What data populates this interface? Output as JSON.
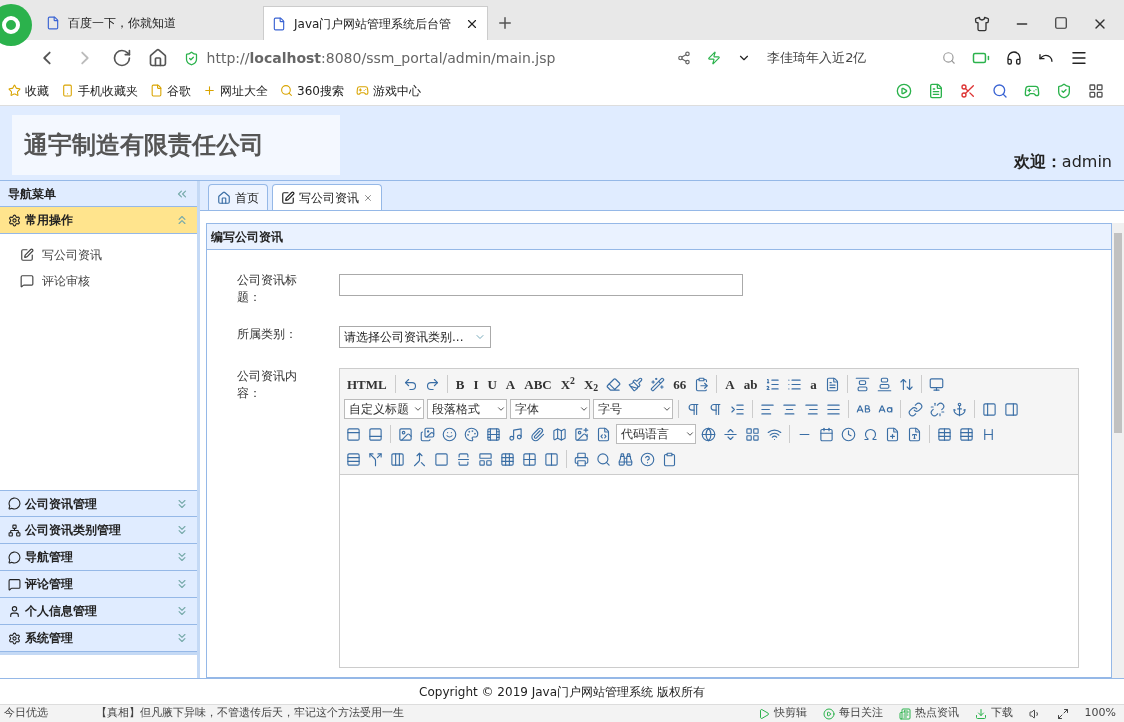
{
  "browser": {
    "tabs": [
      {
        "label": "百度一下，你就知道",
        "selected": false
      },
      {
        "label": "Java门户网站管理系统后台管",
        "selected": true
      }
    ],
    "url": "http://**localhost**:8080/ssm_portal/admin/main.jsp",
    "search_hint": "李佳琦年入近2亿",
    "bookmarks": [
      "收藏",
      "手机收藏夹",
      "谷歌",
      "网址大全",
      "360搜索",
      "游戏中心"
    ]
  },
  "header": {
    "company": "通宇制造有限责任公司",
    "welcome": "欢迎：",
    "user": "admin"
  },
  "sidebar": {
    "title": "导航菜单",
    "panels": [
      {
        "title": "常用操作",
        "expanded": true,
        "items": [
          "写公司资讯",
          "评论审核"
        ]
      },
      {
        "title": "公司资讯管理",
        "expanded": false
      },
      {
        "title": "公司资讯类别管理",
        "expanded": false
      },
      {
        "title": "导航管理",
        "expanded": false
      },
      {
        "title": "评论管理",
        "expanded": false
      },
      {
        "title": "个人信息管理",
        "expanded": false
      },
      {
        "title": "系统管理",
        "expanded": false
      }
    ]
  },
  "tabs": [
    {
      "label": "首页",
      "selected": false,
      "closable": false
    },
    {
      "label": "写公司资讯",
      "selected": true,
      "closable": true
    }
  ],
  "panel": {
    "title": "编写公司资讯",
    "fields": [
      {
        "label": "公司资讯标题：",
        "kind": "input"
      },
      {
        "label": "所属类别：",
        "kind": "select",
        "placeholder": "请选择公司资讯类别..."
      },
      {
        "label": "公司资讯内容：",
        "kind": "editor"
      }
    ]
  },
  "toolbar": [
    [
      {
        "kind": "text",
        "label": "HTML"
      },
      {
        "kind": "sep"
      },
      {
        "kind": "icon"
      },
      {
        "kind": "icon"
      },
      {
        "kind": "sep"
      },
      {
        "kind": "text",
        "label": "B"
      },
      {
        "kind": "text",
        "label": "I"
      },
      {
        "kind": "text",
        "label": "U"
      },
      {
        "kind": "text",
        "label": "A"
      },
      {
        "kind": "text",
        "label": "ABC"
      },
      {
        "kind": "text",
        "label": "X$^{2}$"
      },
      {
        "kind": "text",
        "label": "X$_{2}$"
      },
      {
        "kind": "icon"
      },
      {
        "kind": "icon"
      },
      {
        "kind": "icon"
      },
      {
        "kind": "text",
        "label": "66"
      },
      {
        "kind": "icon"
      },
      {
        "kind": "sep"
      },
      {
        "kind": "text",
        "label": "A"
      },
      {
        "kind": "text",
        "label": "ab"
      },
      {
        "kind": "icon"
      },
      {
        "kind": "icon"
      },
      {
        "kind": "text",
        "label": "a"
      },
      {
        "kind": "icon"
      },
      {
        "kind": "sep"
      },
      {
        "kind": "icon"
      },
      {
        "kind": "icon"
      },
      {
        "kind": "icon"
      },
      {
        "kind": "sep"
      },
      {
        "kind": "icon"
      }
    ],
    [
      {
        "kind": "dropdown",
        "label": "自定义标题"
      },
      {
        "kind": "dropdown",
        "label": "段落格式"
      },
      {
        "kind": "dropdown",
        "label": "字体"
      },
      {
        "kind": "dropdown",
        "label": "字号"
      },
      {
        "kind": "sep"
      },
      {
        "kind": "icon"
      },
      {
        "kind": "icon"
      },
      {
        "kind": "icon"
      },
      {
        "kind": "sep"
      },
      {
        "kind": "icon"
      },
      {
        "kind": "icon"
      },
      {
        "kind": "icon"
      },
      {
        "kind": "icon"
      },
      {
        "kind": "sep"
      },
      {
        "kind": "icon"
      },
      {
        "kind": "icon"
      },
      {
        "kind": "sep"
      },
      {
        "kind": "icon"
      },
      {
        "kind": "icon"
      },
      {
        "kind": "icon"
      },
      {
        "kind": "sep"
      },
      {
        "kind": "icon"
      },
      {
        "kind": "icon"
      }
    ],
    [
      {
        "kind": "icon"
      },
      {
        "kind": "icon"
      },
      {
        "kind": "sep"
      },
      {
        "kind": "icon"
      },
      {
        "kind": "icon"
      },
      {
        "kind": "icon"
      },
      {
        "kind": "icon"
      },
      {
        "kind": "icon"
      },
      {
        "kind": "icon"
      },
      {
        "kind": "icon"
      },
      {
        "kind": "icon"
      },
      {
        "kind": "icon"
      },
      {
        "kind": "icon"
      },
      {
        "kind": "dropdown",
        "label": "代码语言"
      },
      {
        "kind": "icon"
      },
      {
        "kind": "icon"
      },
      {
        "kind": "icon"
      },
      {
        "kind": "icon"
      },
      {
        "kind": "sep"
      },
      {
        "kind": "icon"
      },
      {
        "kind": "icon"
      },
      {
        "kind": "icon"
      },
      {
        "kind": "icon"
      },
      {
        "kind": "icon"
      },
      {
        "kind": "icon"
      },
      {
        "kind": "sep"
      },
      {
        "kind": "icon"
      },
      {
        "kind": "icon"
      },
      {
        "kind": "icon"
      }
    ],
    [
      {
        "kind": "icon"
      },
      {
        "kind": "icon"
      },
      {
        "kind": "icon"
      },
      {
        "kind": "icon"
      },
      {
        "kind": "icon"
      },
      {
        "kind": "icon"
      },
      {
        "kind": "icon"
      },
      {
        "kind": "icon"
      },
      {
        "kind": "icon"
      },
      {
        "kind": "icon"
      },
      {
        "kind": "sep"
      },
      {
        "kind": "icon"
      },
      {
        "kind": "icon"
      },
      {
        "kind": "icon"
      },
      {
        "kind": "icon"
      },
      {
        "kind": "icon"
      }
    ]
  ],
  "footer": "Copyright © 2019 Java门户网站管理系统 版权所有",
  "status_bar": {
    "left": "今日优选",
    "news": "【真相】但凡腋下异味，不管遗传后天，牢记这个方法受用一生",
    "items": [
      "快剪辑",
      "每日关注",
      "热点资讯",
      "下载"
    ],
    "zoom": "100%"
  }
}
